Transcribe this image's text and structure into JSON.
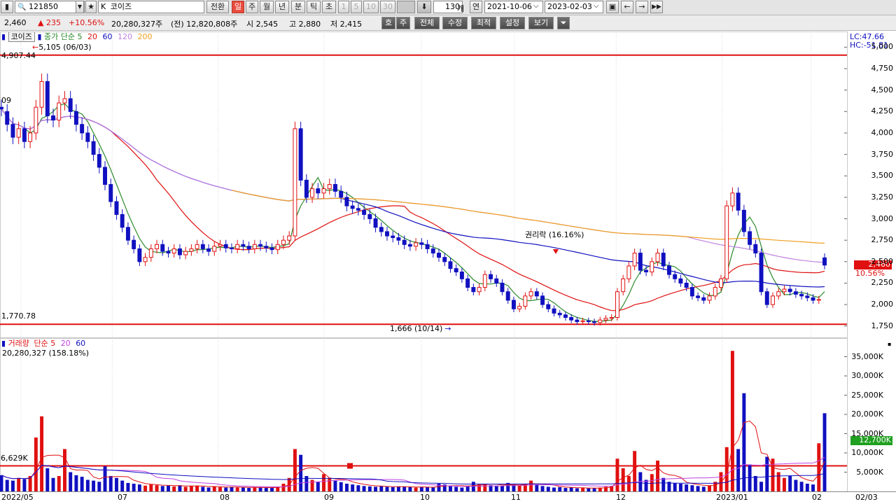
{
  "toolbar": {
    "code": "121850",
    "market_prefix": "K",
    "stock_name": "코이즈",
    "switch_label": "전환",
    "periods": [
      "일",
      "주",
      "월",
      "년",
      "분",
      "틱",
      "초"
    ],
    "active_period": "일",
    "minute_options": [
      "1",
      "5",
      "10",
      "30"
    ],
    "count": "130",
    "count_unit": "개",
    "year_toggle": "연",
    "date_from": "2021-10-06",
    "date_to": "2023-02-03"
  },
  "quote": {
    "price": "2,460",
    "change": "▲ 235",
    "change_pct": "+10.56%",
    "volume": "20,280,327주",
    "prev_volume": "(전) 12,820,808주",
    "open": "시 2,545",
    "high": "고 2,880",
    "low": "저 2,415",
    "buttons": [
      "호",
      "주",
      "전체",
      "수정",
      "최적",
      "설정",
      "보기"
    ]
  },
  "price_panel": {
    "legend_name": "코이즈",
    "legend_type": "종가 단순",
    "ma_periods": [
      "5",
      "20",
      "60",
      "120",
      "200"
    ],
    "ma_colors": [
      "#2a8a2a",
      "#e01010",
      "#1010c0",
      "#c080e0",
      "#f0a020"
    ],
    "lc_label": "LC:47.66",
    "hc_label": "HC:-51.81",
    "high_line_label": "4,907.44",
    "high_marker": "5,105 (06/03)",
    "low_line_label": "1,770.78",
    "low_marker": "1,666 (10/14)",
    "left_edge_label": "09",
    "event_label": "권리락 (16.16%)",
    "current_price_tag": "2,460",
    "current_pct_tag": "10.56%",
    "y_ticks": [
      "5,000",
      "4,750",
      "4,500",
      "4,250",
      "4,000",
      "3,750",
      "3,500",
      "3,250",
      "3,000",
      "2,750",
      "2,500",
      "2,250",
      "2,000",
      "1,750"
    ]
  },
  "volume_panel": {
    "legend_name": "거래량",
    "legend_type": "단순",
    "ma_periods": [
      "5",
      "20",
      "60"
    ],
    "ma_colors": [
      "#e01010",
      "#c040e0",
      "#1010c0"
    ],
    "volume_text": "20,280,327 (158.18%)",
    "ref_label": "6,629K",
    "current_tag": "12,700K",
    "y_ticks": [
      "35,000K",
      "30,000K",
      "25,000K",
      "20,000K",
      "15,000K",
      "10,000K",
      "5,000K"
    ]
  },
  "x_axis": {
    "labels": [
      "2022/05",
      "07",
      "08",
      "09",
      "10",
      "11",
      "12",
      "2023/01",
      "02",
      "02/03"
    ]
  },
  "chart_data": {
    "type": "candlestick",
    "title": "",
    "x_labels": [
      "2022/05",
      "07",
      "08",
      "09",
      "10",
      "11",
      "12",
      "2023/01",
      "02"
    ],
    "y_range": [
      1650,
      5150
    ],
    "reference_lines": {
      "high": 4907.44,
      "low": 1770.78
    },
    "period_high": {
      "value": 5105,
      "date": "06/03"
    },
    "period_low": {
      "value": 1666,
      "date": "10/14"
    },
    "last": {
      "price": 2460,
      "open": 2545,
      "high": 2880,
      "low": 2415,
      "change": 235,
      "change_pct": 10.56
    },
    "moving_average_last": {
      "ma5": 2120,
      "ma20": 2290,
      "ma60": 2280,
      "ma120": 2370,
      "ma200": 2660
    },
    "volume": {
      "last": 20280327,
      "ma_tag": 12700000,
      "reference": 6629000,
      "y_range": [
        0,
        38000000
      ]
    },
    "closes": [
      4280,
      4100,
      3950,
      4050,
      3900,
      4000,
      4300,
      4600,
      4200,
      4150,
      4350,
      4400,
      4250,
      4100,
      4000,
      3900,
      3750,
      3600,
      3400,
      3200,
      3050,
      2900,
      2750,
      2650,
      2500,
      2550,
      2650,
      2700,
      2620,
      2600,
      2650,
      2580,
      2620,
      2650,
      2700,
      2650,
      2620,
      2680,
      2700,
      2660,
      2650,
      2700,
      2680,
      2650,
      2700,
      2680,
      2660,
      2640,
      2700,
      2750,
      2800,
      4050,
      3450,
      3250,
      3350,
      3300,
      3350,
      3400,
      3320,
      3250,
      3150,
      3120,
      3100,
      3050,
      3000,
      2900,
      2850,
      2800,
      2780,
      2750,
      2700,
      2680,
      2720,
      2700,
      2650,
      2600,
      2550,
      2500,
      2420,
      2380,
      2300,
      2200,
      2150,
      2200,
      2350,
      2300,
      2250,
      2150,
      2050,
      1950,
      1980,
      2100,
      2150,
      2100,
      2000,
      1950,
      1900,
      1880,
      1850,
      1820,
      1800,
      1810,
      1800,
      1790,
      1820,
      1840,
      1850,
      2150,
      2300,
      2450,
      2600,
      2400,
      2380,
      2500,
      2600,
      2450,
      2350,
      2300,
      2250,
      2200,
      2100,
      2080,
      2050,
      2100,
      2200,
      2300,
      3150,
      3300,
      3100,
      2850,
      2700,
      2600,
      2150,
      2000,
      2100,
      2150,
      2180,
      2150,
      2120,
      2100,
      2080,
      2050,
      2060,
      2460
    ],
    "opens": [
      4300,
      4250,
      4100,
      3950,
      4050,
      3900,
      4000,
      4300,
      4600,
      4200,
      4150,
      4350,
      4400,
      4250,
      4100,
      4000,
      3900,
      3750,
      3600,
      3400,
      3200,
      3050,
      2900,
      2750,
      2650,
      2500,
      2550,
      2650,
      2700,
      2620,
      2600,
      2650,
      2580,
      2620,
      2650,
      2700,
      2650,
      2620,
      2680,
      2700,
      2660,
      2650,
      2700,
      2680,
      2650,
      2700,
      2680,
      2660,
      2640,
      2700,
      2750,
      2800,
      4050,
      3450,
      3250,
      3350,
      3300,
      3350,
      3400,
      3320,
      3250,
      3150,
      3120,
      3100,
      3050,
      3000,
      2900,
      2850,
      2800,
      2780,
      2750,
      2700,
      2680,
      2720,
      2700,
      2650,
      2600,
      2550,
      2500,
      2420,
      2380,
      2300,
      2200,
      2150,
      2200,
      2350,
      2300,
      2250,
      2150,
      2050,
      1950,
      1980,
      2100,
      2150,
      2100,
      2000,
      1950,
      1900,
      1880,
      1850,
      1820,
      1800,
      1810,
      1800,
      1790,
      1820,
      1840,
      1850,
      2150,
      2300,
      2450,
      2600,
      2400,
      2380,
      2500,
      2600,
      2450,
      2350,
      2300,
      2250,
      2200,
      2100,
      2080,
      2050,
      2100,
      2200,
      2300,
      3150,
      3300,
      3100,
      2850,
      2700,
      2600,
      2150,
      2000,
      2100,
      2150,
      2180,
      2150,
      2120,
      2100,
      2080,
      2050,
      2545
    ],
    "volumes": [
      4.2,
      3.0,
      2.8,
      3.5,
      3.2,
      4.0,
      14.0,
      19.5,
      6.0,
      3.5,
      4.0,
      11.0,
      5.0,
      4.2,
      3.8,
      3.0,
      2.8,
      2.5,
      6.5,
      4.0,
      3.5,
      2.8,
      2.2,
      2.0,
      1.8,
      1.5,
      1.8,
      1.6,
      1.4,
      1.5,
      1.3,
      1.6,
      1.2,
      1.4,
      1.5,
      1.2,
      1.0,
      1.3,
      1.1,
      1.0,
      1.2,
      1.0,
      1.1,
      0.9,
      1.0,
      1.1,
      0.9,
      1.0,
      1.2,
      2.0,
      3.5,
      11.0,
      9.5,
      4.0,
      3.0,
      2.5,
      4.5,
      3.5,
      2.8,
      2.4,
      2.0,
      1.8,
      1.6,
      1.4,
      1.3,
      1.2,
      1.4,
      1.2,
      1.1,
      1.3,
      1.2,
      1.1,
      1.0,
      1.2,
      1.1,
      1.0,
      2.0,
      1.8,
      1.4,
      1.2,
      1.0,
      1.5,
      2.5,
      1.8,
      2.0,
      1.6,
      1.5,
      1.4,
      2.2,
      1.8,
      1.5,
      2.0,
      2.8,
      1.8,
      1.4,
      1.2,
      1.0,
      1.1,
      0.9,
      1.0,
      0.8,
      0.9,
      0.8,
      0.9,
      1.0,
      1.2,
      1.4,
      8.5,
      6.0,
      4.0,
      10.5,
      5.0,
      3.0,
      4.5,
      8.0,
      3.5,
      2.5,
      2.2,
      2.0,
      1.8,
      1.6,
      1.4,
      1.2,
      1.5,
      2.5,
      5.0,
      11.5,
      36.5,
      11.0,
      25.5,
      7.0,
      4.0,
      2.5,
      9.0,
      8.5,
      5.0,
      3.5,
      4.0,
      3.0,
      2.5,
      2.0,
      1.8,
      12.5,
      20.3
    ]
  }
}
